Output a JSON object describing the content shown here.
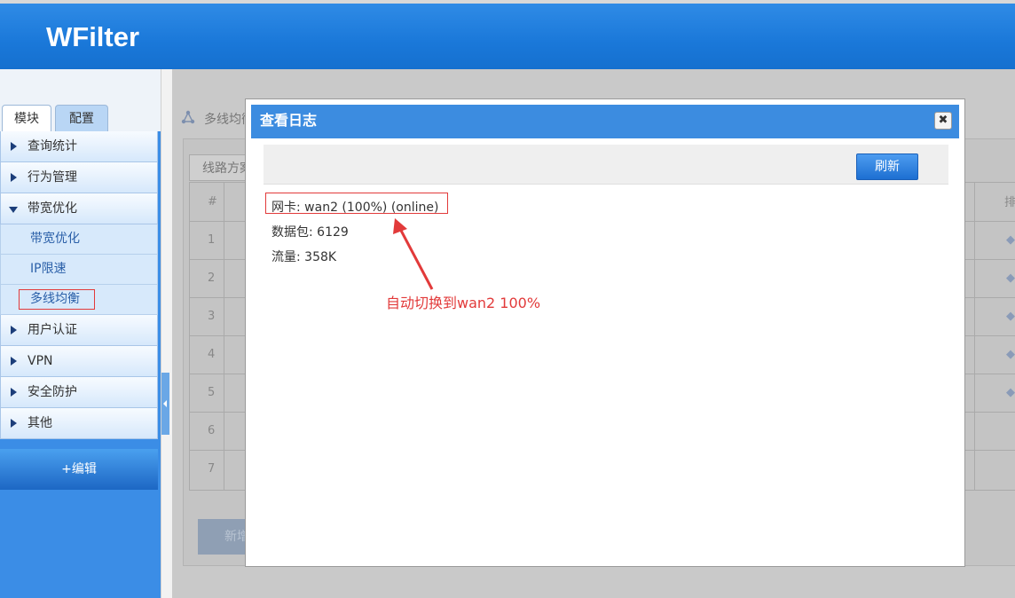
{
  "header": {
    "brand": "WFilter"
  },
  "sidebar": {
    "tabs": [
      {
        "label": "模块"
      },
      {
        "label": "配置"
      }
    ],
    "items": [
      {
        "label": "查询统计"
      },
      {
        "label": "行为管理"
      },
      {
        "label": "带宽优化"
      },
      {
        "label": "用户认证"
      },
      {
        "label": "VPN"
      },
      {
        "label": "安全防护"
      },
      {
        "label": "其他"
      }
    ],
    "sub_items": [
      {
        "label": "带宽优化"
      },
      {
        "label": "IP限速"
      },
      {
        "label": "多线均衡"
      }
    ],
    "edit_label": "+编辑"
  },
  "background": {
    "breadcrumb": "多线均衡",
    "subtab": "线路方案",
    "col_hash": "#",
    "col_sort": "排",
    "rows": [
      "1",
      "2",
      "3",
      "4",
      "5",
      "6",
      "7"
    ],
    "new_button": "新增"
  },
  "modal": {
    "title": "查看日志",
    "close_symbol": "✖",
    "refresh_label": "刷新",
    "lines": [
      "网卡: wan2  (100%)  (online)",
      "数据包:  6129",
      "流量:  358K"
    ],
    "annotation": "自动切换到wan2 100%"
  },
  "colors": {
    "header_blue": "#1a78d9",
    "title_bar": "#3c8ce0",
    "annotation_red": "#e23a3a"
  }
}
